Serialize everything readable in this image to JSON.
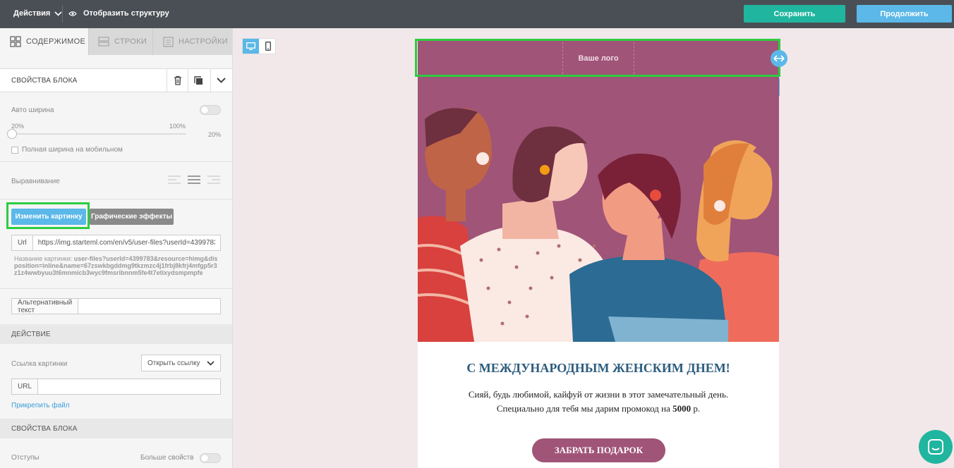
{
  "topbar": {
    "actions_label": "Действия",
    "structure_label": "Отобразить структуру",
    "save_label": "Сохранить",
    "continue_label": "Продолжить"
  },
  "tabs": [
    {
      "label": "СОДЕРЖИМОЕ",
      "icon": "grid-icon",
      "active": true
    },
    {
      "label": "СТРОКИ",
      "icon": "rows-icon",
      "active": false
    },
    {
      "label": "НАСТРОЙКИ",
      "icon": "settings-doc-icon",
      "active": false
    }
  ],
  "block": {
    "title": "СВОЙСТВА БЛОКА",
    "auto_width_label": "Авто ширина",
    "slider_min": "20%",
    "slider_max": "100%",
    "slider_value": "20%",
    "full_width_mobile_label": "Полная ширина на мобильном",
    "align_label": "Выравнивание",
    "change_image_label": "Изменить картинку",
    "effects_label": "Графические эффекты",
    "url_prefix": "Url",
    "url_value": "https://img.starteml.com/en/v5/user-files?userId=4399783",
    "image_name_label": "Название картинки:",
    "image_name_value": "user-files?userId=4399783&resource=himg&disposition=inline&name=67zswkbgddmg9tkzmzc4j1frbj8kfrj4mfgp5r3z1z4wwbyuu3t6mnmicb3wyc9fmsribnnm5fe4t7etixydsmpmpfe",
    "alt_label": "Альтернативный текст",
    "alt_value": ""
  },
  "action": {
    "title": "ДЕЙСТВИЕ",
    "link_label": "Ссылка картинки",
    "link_select": "Открыть ссылку",
    "url_prefix": "URL",
    "url_value": "",
    "attach_label": "Прикрепить файл"
  },
  "block2": {
    "title": "СВОЙСТВА БЛОКА",
    "padding_label": "Отступы",
    "more_label": "Больше свойств"
  },
  "email": {
    "logo_text": "Ваше лого",
    "headline": "С МЕЖДУНАРОДНЫМ ЖЕНСКИМ ДНЕМ!",
    "body_line1": "Сияй, будь любимой, кайфуй от жизни в этот замечательный день.",
    "body_line2_pre": "Специально для тебя мы дарим промокод на ",
    "body_line2_bold": "5000",
    "body_line2_post": " р.",
    "cta_label": "ЗАБРАТЬ ПОДАРОК"
  },
  "colors": {
    "accent_teal": "#20b59f",
    "accent_blue": "#5bb8e8",
    "brand_purple": "#a05478",
    "headline_blue": "#2c5c7e"
  }
}
